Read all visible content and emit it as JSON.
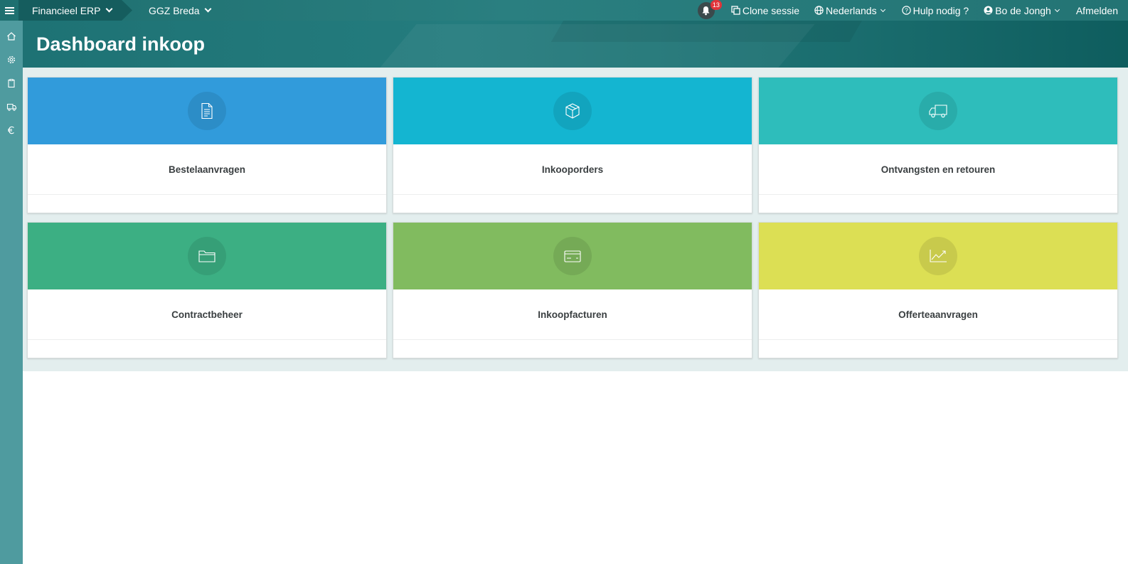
{
  "topbar": {
    "app_label": "Financieel ERP",
    "org_label": "GGZ Breda",
    "notifications_count": "13",
    "clone_label": "Clone sessie",
    "language_label": "Nederlands",
    "help_label": "Hulp nodig ?",
    "user_label": "Bo de Jongh",
    "logout_label": "Afmelden"
  },
  "sidebar": {
    "icons": [
      "home-icon",
      "gear-icon",
      "clipboard-icon",
      "truck-icon",
      "euro-icon"
    ]
  },
  "page": {
    "title": "Dashboard inkoop"
  },
  "tiles": [
    {
      "label": "Bestelaanvragen",
      "color": "#319bdb",
      "icon": "document-icon"
    },
    {
      "label": "Inkooporders",
      "color": "#14b5d1",
      "icon": "box-icon"
    },
    {
      "label": "Ontvangsten en retouren",
      "color": "#2ebdbb",
      "icon": "truck-icon"
    },
    {
      "label": "Contractbeheer",
      "color": "#3caf83",
      "icon": "folder-icon"
    },
    {
      "label": "Inkoopfacturen",
      "color": "#81bb5f",
      "icon": "credit-card-icon"
    },
    {
      "label": "Offerteaanvragen",
      "color": "#dcdf54",
      "icon": "trend-chart-icon"
    }
  ],
  "colors": {
    "topbar": "#237474",
    "sidebar": "#4f9b9f",
    "content_bg": "#e3eeee",
    "badge": "#e0343a"
  }
}
